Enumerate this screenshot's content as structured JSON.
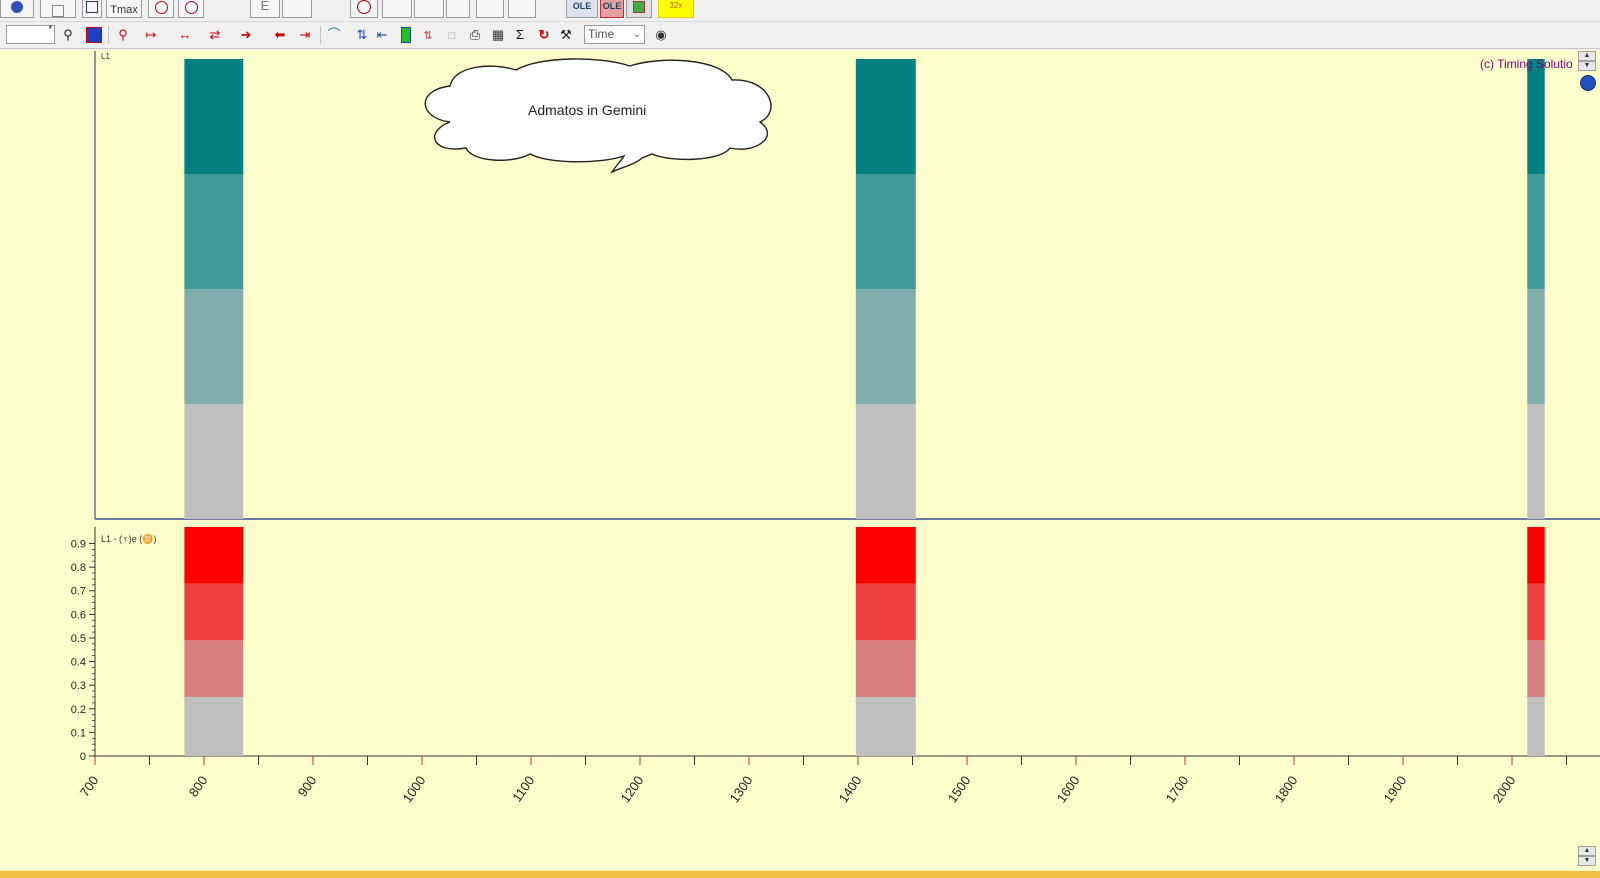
{
  "toolbar_top": {
    "tmax_label": "Tmax",
    "e_label": "E",
    "ole1_label": "OLE",
    "ole2_label": "OLE",
    "badge_label": "32x"
  },
  "toolbar_second": {
    "time_select": "Time",
    "icons": [
      "zoom-icon",
      "color-select-icon",
      "zoom-fit-icon",
      "stretch-icon",
      "expand-icon",
      "compress-icon",
      "arrow-right-icon",
      "arrow-left-icon",
      "end-icon",
      "arc-icon",
      "split-icon",
      "align-icon",
      "color-bar-icon",
      "step-icon",
      "page-icon",
      "print-icon",
      "grid-icon",
      "sigma-icon",
      "cycle-icon",
      "tool-icon",
      "lock-icon"
    ]
  },
  "copyright": "(c) Timing Solutio",
  "callout": "Admatos in Gemini",
  "upper_panel_label": "L1",
  "lower_panel_label": "L1 - (♆)e (♊)",
  "colors": {
    "panel_bg": "#ffffcc",
    "teal_1": "#008080",
    "teal_2": "#409898",
    "teal_3": "#80aeac",
    "gray": "#c0c0c0",
    "red_1": "#ff0000",
    "red_2": "#ee4040",
    "red_3": "#d88080"
  },
  "chart_data": {
    "type": "bar",
    "xlim": [
      700,
      2030
    ],
    "x_ticks": [
      "700",
      "800",
      "900",
      "1000",
      "1100",
      "1200",
      "1300",
      "1400",
      "1500",
      "1600",
      "1700",
      "1800",
      "1900",
      "2000"
    ],
    "y_ticks": [
      "0",
      "0.1",
      "0.2",
      "0.3",
      "0.4",
      "0.5",
      "0.6",
      "0.7",
      "0.8",
      "0.9"
    ],
    "ylim": [
      0,
      0.97
    ],
    "bands": [
      {
        "x_start": 782,
        "x_end": 836
      },
      {
        "x_start": 1398,
        "x_end": 1453
      },
      {
        "x_start": 2014,
        "x_end": 2030
      }
    ],
    "lower_segments": [
      0.25,
      0.49,
      0.73,
      0.97
    ]
  }
}
